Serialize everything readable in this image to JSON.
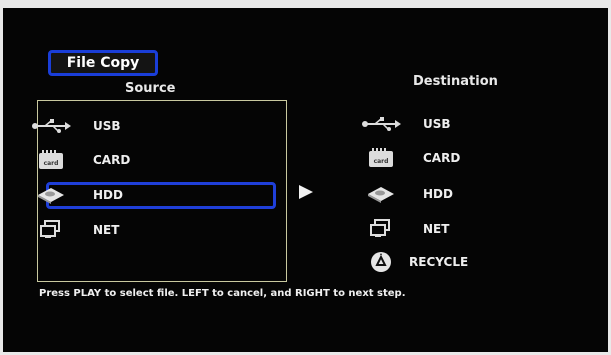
{
  "title": "File Copy",
  "source": {
    "heading": "Source",
    "items": [
      {
        "label": "USB",
        "icon": "usb-icon"
      },
      {
        "label": "CARD",
        "icon": "card-icon"
      },
      {
        "label": "HDD",
        "icon": "hdd-icon",
        "selected": true
      },
      {
        "label": "NET",
        "icon": "net-icon"
      }
    ]
  },
  "destination": {
    "heading": "Destination",
    "items": [
      {
        "label": "USB",
        "icon": "usb-icon"
      },
      {
        "label": "CARD",
        "icon": "card-icon"
      },
      {
        "label": "HDD",
        "icon": "hdd-icon"
      },
      {
        "label": "NET",
        "icon": "net-icon"
      },
      {
        "label": "RECYCLE",
        "icon": "recycle-icon"
      }
    ]
  },
  "card_icon_text": "card",
  "hint": "Press PLAY to select file. LEFT to cancel, and RIGHT to next step.",
  "colors": {
    "accent": "#1f3fd9",
    "background": "#050505",
    "text": "#efefef"
  }
}
